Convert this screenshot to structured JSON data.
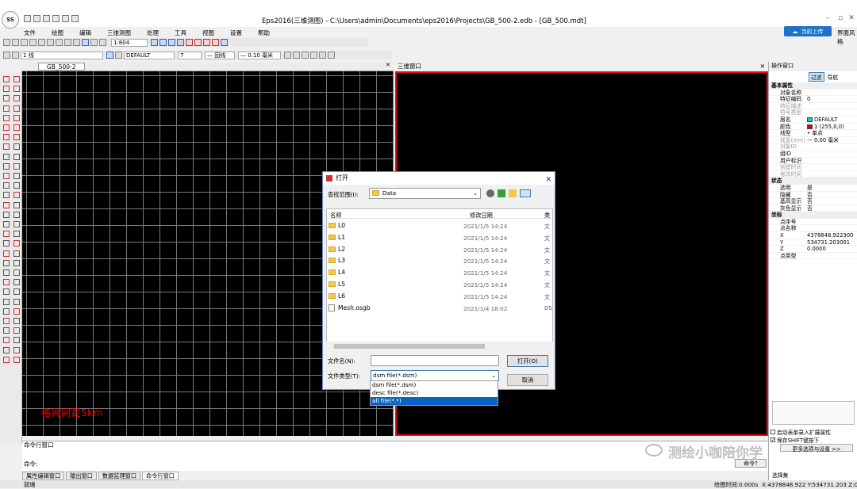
{
  "app": {
    "logo_text": "SS",
    "title": "Eps2016(三维测图) - C:\\Users\\admin\\Documents\\eps2016\\Projects\\GB_500-2.edb - [GB_500.mdt]",
    "cloud_button": "当前上传",
    "skin_label": "界面风格"
  },
  "menu": [
    "文件",
    "绘图",
    "编辑",
    "三维测图",
    "处理",
    "工具",
    "视图",
    "设置",
    "帮助"
  ],
  "toolbar": {
    "scale_value": "1:804",
    "line_label": "1 线",
    "layer_value": "DEFAULT",
    "color_value": "7",
    "linetype_value": "— 固线",
    "lineweight_value": "— 0.10 毫米"
  },
  "view2d": {
    "tab_label": "GB_500-2",
    "grid_label": "格网间距5km"
  },
  "view3d": {
    "title": "三维窗口",
    "border_color": "#e01010"
  },
  "props": {
    "title": "操作窗口",
    "tab_filter": "过滤",
    "tab_nav": "导航",
    "groups": [
      {
        "name": "基本属性",
        "rows": [
          {
            "k": "对象名称",
            "v": ""
          },
          {
            "k": "特征编码",
            "v": "0"
          },
          {
            "k": "特征描述",
            "v": "",
            "dim": true
          },
          {
            "k": "符号类型",
            "v": "",
            "dim": true
          },
          {
            "k": "层名",
            "v": "DEFAULT",
            "swatch": "#22c4d4"
          },
          {
            "k": "颜色",
            "v": "1 (255,0,0)",
            "swatch": "#dd0000"
          },
          {
            "k": "线型",
            "v": "• 单点"
          },
          {
            "k": "线宽(mm)",
            "v": "— 0.00 毫米",
            "dim": true
          },
          {
            "k": "对象ID",
            "v": "",
            "dim": true
          },
          {
            "k": "组ID",
            "v": ""
          },
          {
            "k": "用户标识",
            "v": ""
          },
          {
            "k": "创建时间",
            "v": "",
            "dim": true
          },
          {
            "k": "修改时间",
            "v": "",
            "dim": true
          }
        ]
      },
      {
        "name": "状态",
        "rows": [
          {
            "k": "选明",
            "v": "是"
          },
          {
            "k": "隐藏",
            "v": "否"
          },
          {
            "k": "基高显示",
            "v": "否"
          },
          {
            "k": "灰色显示",
            "v": "否"
          }
        ]
      },
      {
        "name": "坐标",
        "rows": [
          {
            "k": "点序号",
            "v": ""
          },
          {
            "k": "点名称",
            "v": ""
          },
          {
            "k": "X",
            "v": "4378848.922300"
          },
          {
            "k": "Y",
            "v": "534731.203001"
          },
          {
            "k": "Z",
            "v": "0.0000"
          },
          {
            "k": "点类型",
            "v": ""
          }
        ]
      }
    ],
    "check_auto": "启动表单录入扩展属性",
    "check_snap": "保存SHIFT键按下",
    "more_options": "更多选项与设置 >>",
    "selection_label": "选择集"
  },
  "command": {
    "title": "命令行窗口",
    "prompt": "命令:",
    "button": "命令?"
  },
  "bottom_tabs": [
    "属性编辑窗口",
    "输出窗口",
    "数据监理窗口",
    "命令行窗口"
  ],
  "status": {
    "left": "就绪",
    "draw_time": "绘图时间:0.000s",
    "coords": "X:4378848.922 Y:534731.203 Z:0.00"
  },
  "dialog": {
    "title": "打开",
    "lookin_label": "查找范围(I):",
    "lookin_value": "Data",
    "col_name": "名称",
    "col_date": "修改日期",
    "col_type": "类",
    "files": [
      {
        "name": "L0",
        "date": "2021/1/5 14:24",
        "type": "文",
        "kind": "folder"
      },
      {
        "name": "L1",
        "date": "2021/1/5 14:24",
        "type": "文",
        "kind": "folder"
      },
      {
        "name": "L2",
        "date": "2021/1/5 14:24",
        "type": "文",
        "kind": "folder"
      },
      {
        "name": "L3",
        "date": "2021/1/5 14:24",
        "type": "文",
        "kind": "folder"
      },
      {
        "name": "L4",
        "date": "2021/1/5 14:24",
        "type": "文",
        "kind": "folder"
      },
      {
        "name": "L5",
        "date": "2021/1/5 14:24",
        "type": "文",
        "kind": "folder"
      },
      {
        "name": "L6",
        "date": "2021/1/5 14:24",
        "type": "文",
        "kind": "folder"
      },
      {
        "name": "Mesh.osgb",
        "date": "2021/1/4 18:02",
        "type": "DS",
        "kind": "file"
      }
    ],
    "filename_label": "文件名(N):",
    "filename_value": "",
    "filetype_label": "文件类型(T):",
    "filetype_value": "dsm file(*.dsm)",
    "filetype_options": [
      "dsm file(*.dsm)",
      "desc file(*.desc)",
      "all file(*.*)"
    ],
    "filetype_highlight": 2,
    "open_button": "打开(O)",
    "cancel_button": "取消"
  },
  "watermark": "测绘小咖陪你学"
}
